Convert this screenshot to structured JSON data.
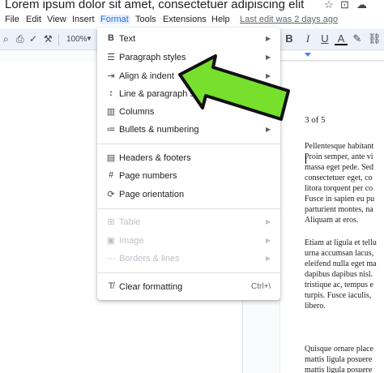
{
  "title": "Lorem ipsum dolor sit amet, consectetuer adipiscing elit",
  "title_icons": [
    "star-icon",
    "folder-move-icon",
    "cloud-status-icon"
  ],
  "menu": [
    "File",
    "Edit",
    "View",
    "Insert",
    "Format",
    "Tools",
    "Extensions",
    "Help"
  ],
  "last_edit": "Last edit was 2 days ago",
  "toolbar": {
    "zoom": "100%",
    "bold": "B",
    "italic": "I",
    "underline": "U",
    "text_color": "A"
  },
  "format_menu": {
    "items": [
      {
        "label": "Text",
        "icon": "bold-icon",
        "submenu": true
      },
      {
        "label": "Paragraph styles",
        "icon": "paragraph-styles-icon",
        "submenu": true
      },
      {
        "label": "Align & indent",
        "icon": "align-indent-icon",
        "submenu": true
      },
      {
        "label": "Line & paragraph spacing",
        "icon": "line-spacing-icon",
        "submenu": true
      },
      {
        "label": "Columns",
        "icon": "columns-icon",
        "submenu": true
      },
      {
        "label": "Bullets & numbering",
        "icon": "bullets-icon",
        "submenu": true
      },
      {
        "label": "Headers & footers",
        "icon": "headers-footers-icon"
      },
      {
        "label": "Page numbers",
        "icon": "page-numbers-icon"
      },
      {
        "label": "Page orientation",
        "icon": "page-orientation-icon"
      },
      {
        "label": "Table",
        "icon": "table-icon",
        "submenu": true,
        "disabled": true
      },
      {
        "label": "Image",
        "icon": "image-icon",
        "submenu": true,
        "disabled": true
      },
      {
        "label": "Borders & lines",
        "icon": "borders-icon",
        "submenu": true,
        "disabled": true
      },
      {
        "label": "Clear formatting",
        "icon": "clear-formatting-icon",
        "shortcut": "Ctrl+\\"
      }
    ]
  },
  "document": {
    "page_number": "3 of 5",
    "para1": "Pellentesque habitant\nProin semper, ante vi\nmassa eget pede. Sed\nconsectetuer eget, co\nlitora torquent per co\nFusce in sapien eu pu\nparturient montes, na\nAliquam at eros.",
    "para2": "Etiam at ligula et tellu\nurna accumsan lacus,\neleifend nulla eget ma\ndapibus dapibus nisl.\ntristique ac, tempus e\nturpis. Fusce iaculis,\nlibero.",
    "para3": "Quisque ornare place\nmattis ligula posuere\nmattis ligula posuere"
  },
  "colors": {
    "arrow_fill": "#76e02c",
    "menu_active": "#e8f0fe",
    "accent": "#1a73e8"
  }
}
